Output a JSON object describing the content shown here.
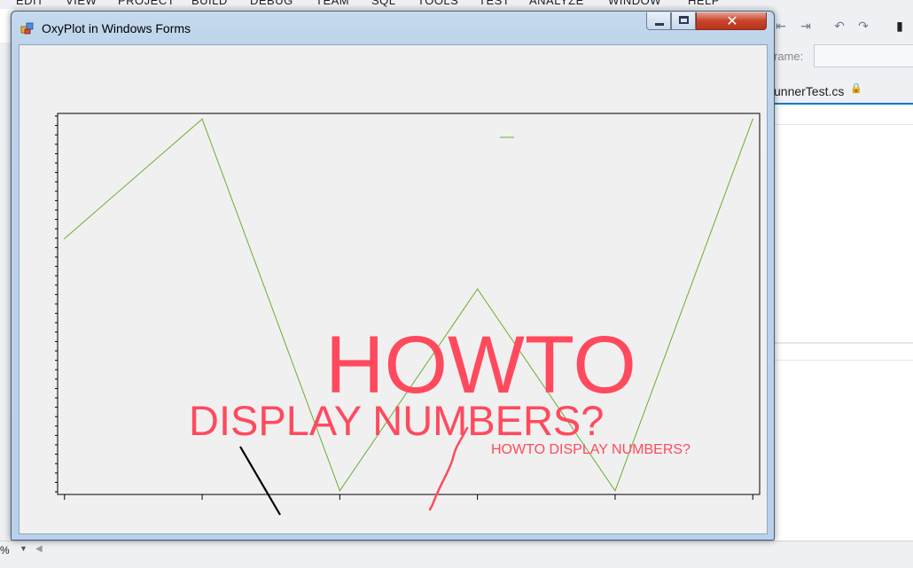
{
  "ide": {
    "menu": [
      "EDIT",
      "VIEW",
      "PROJECT",
      "BUILD",
      "DEBUG",
      "TEAM",
      "SQL",
      "TOOLS",
      "TEST",
      "ANALYZE",
      "WINDOW",
      "HELP"
    ],
    "frame_label": "rame:",
    "tab_label": "unnerTest.cs",
    "zoom_label": "%"
  },
  "window": {
    "title": "OxyPlot in Windows Forms",
    "close_glyph": "✕"
  },
  "annotations": {
    "big_line1": "HOWTO",
    "big_line2": "DISPLAY NUMBERS?",
    "small": "HOWTO DISPLAY NUMBERS?",
    "annotation_color": "#ff4a5e"
  },
  "chart_data": {
    "type": "line",
    "x": [
      0,
      1,
      2,
      3,
      4,
      5
    ],
    "values": [
      0.35,
      0.99,
      -1.0,
      0.08,
      -1.0,
      0.99
    ],
    "series_color": "#6aae2f",
    "xlim": [
      -0.05,
      5.05
    ],
    "ylim": [
      -1.02,
      1.02
    ],
    "x_major_ticks": [
      0,
      1,
      2,
      3,
      4,
      5
    ],
    "y_minor_tick_count": 40,
    "legend": "top-center",
    "grid": false
  }
}
